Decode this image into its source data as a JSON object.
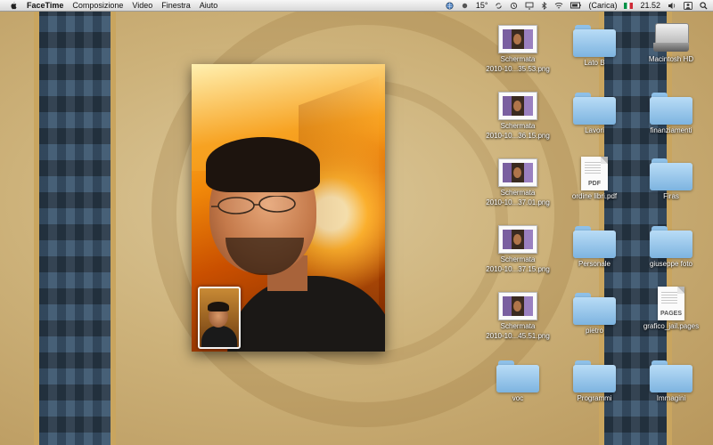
{
  "menubar": {
    "app_name": "FaceTime",
    "menus": [
      "Composizione",
      "Video",
      "Finestra",
      "Aiuto"
    ],
    "status": {
      "temperature": "15°",
      "battery": "(Carica)",
      "time": "21.52"
    }
  },
  "facetime": {
    "remote_video": "camera-feed",
    "local_preview": "self-preview"
  },
  "desktop_icons": {
    "screenshots": [
      {
        "name": "Schermata",
        "detail": "2010-10...35.53.png"
      },
      {
        "name": "Schermata",
        "detail": "2010-10...36.15.png"
      },
      {
        "name": "Schermata",
        "detail": "2010-10...37.01.png"
      },
      {
        "name": "Schermata",
        "detail": "2010-10...37.15.png"
      },
      {
        "name": "Schermata",
        "detail": "2010-10...45.51.png"
      }
    ],
    "col2": [
      "Lato B",
      "Lavori",
      "ordine libri.pdf",
      "Personale",
      "pietro",
      "Programmi"
    ],
    "col3": [
      "Macintosh HD",
      "finanziamenti",
      "Firas",
      "giuseppe foto",
      "grafico_jail.pages",
      "Immagini"
    ],
    "folder_col1": "voc",
    "pdf_tag": "PDF",
    "pages_tag": "PAGES"
  },
  "colors": {
    "wallpaper": "#cdb27a",
    "band": "#3d5770",
    "folder": "#7db4e0"
  }
}
